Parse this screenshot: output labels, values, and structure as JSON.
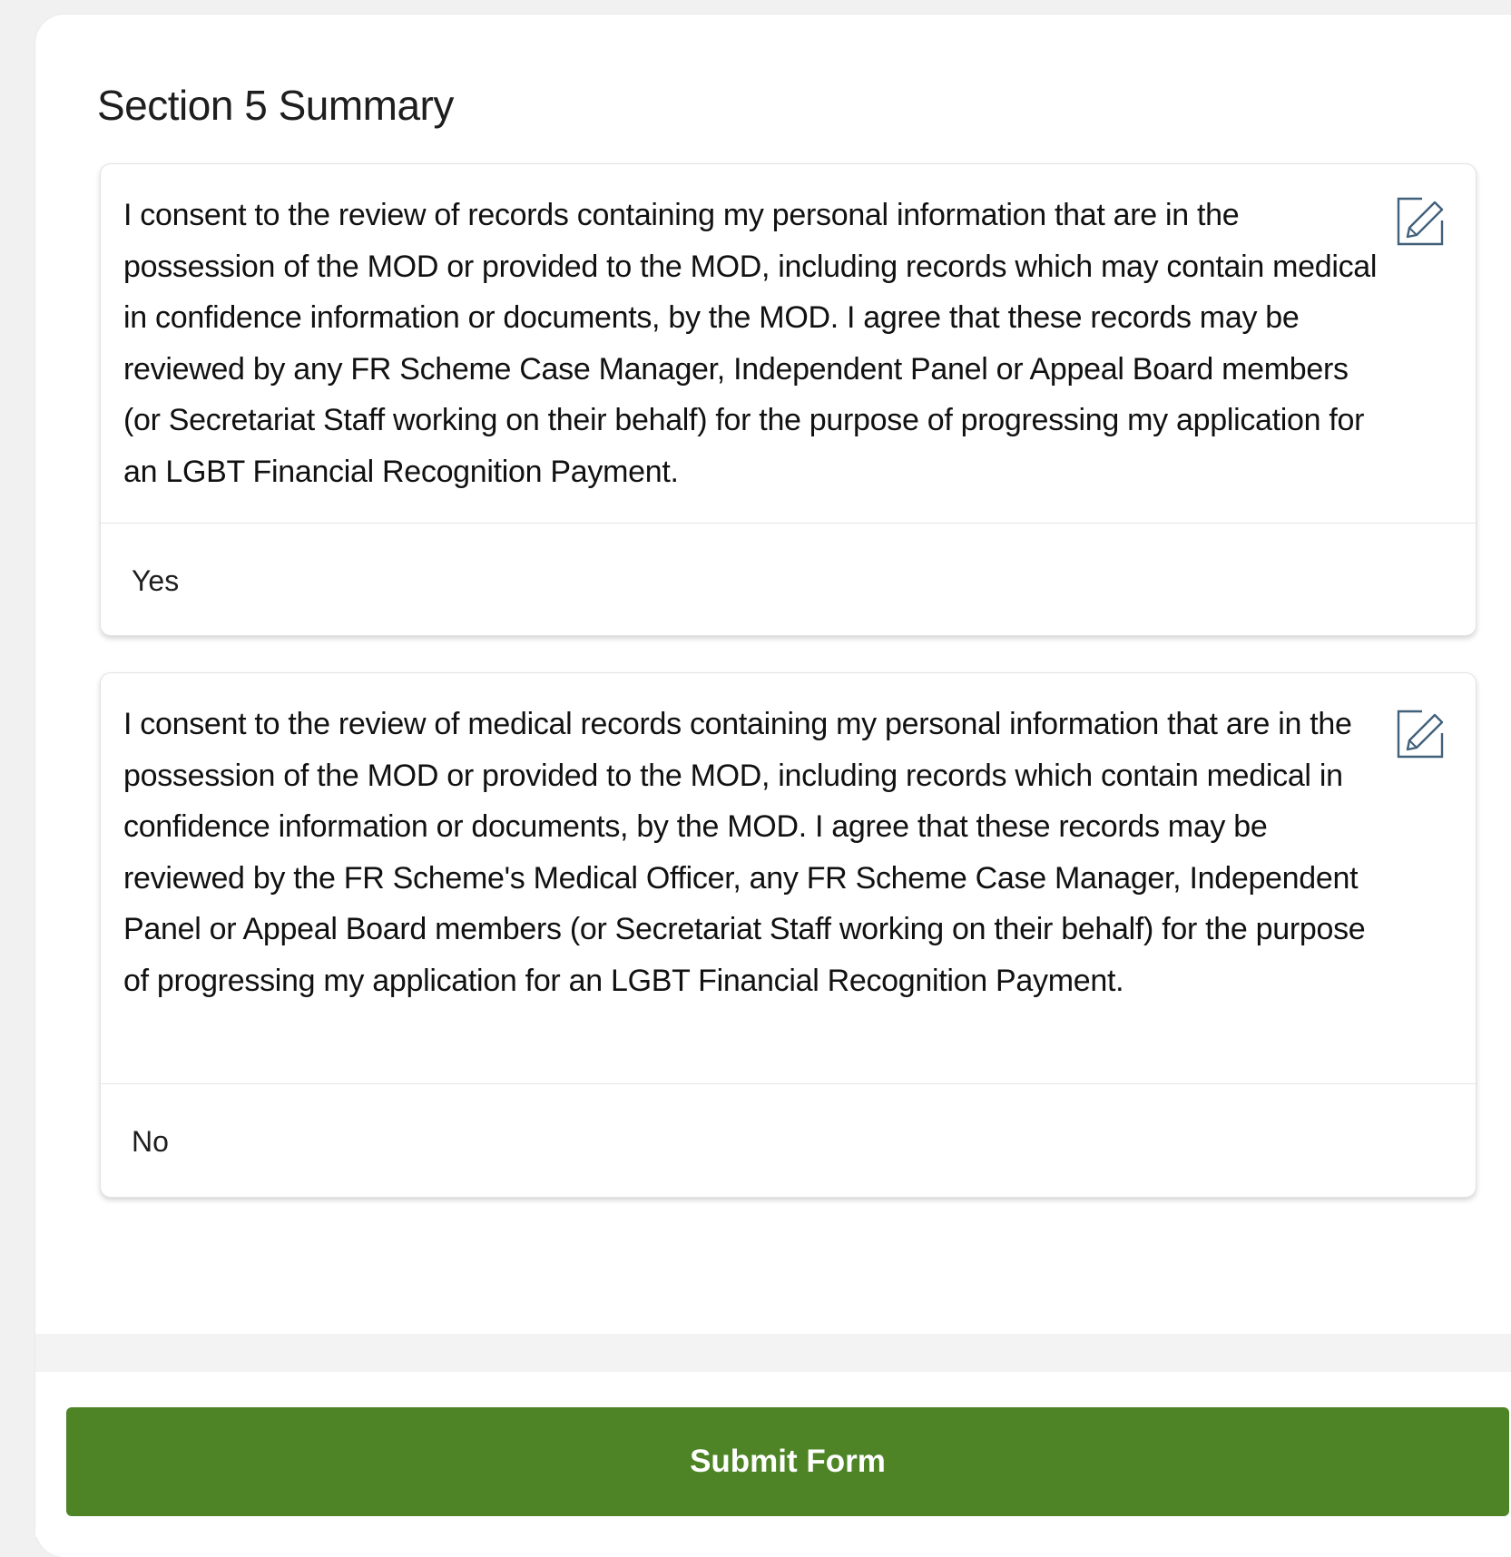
{
  "section": {
    "title": "Section 5 Summary"
  },
  "cards": [
    {
      "question": "I consent to the review of records containing my personal information that are in the possession of the MOD or provided to the MOD, including records which may contain medical in confidence information or documents, by the MOD. I agree that these records may be reviewed by any FR Scheme Case Manager, Independent Panel or Appeal Board members (or Secretariat Staff working on their behalf) for the purpose of progressing my application for an LGBT Financial Recognition Payment.",
      "answer": "Yes",
      "edit_icon": "edit-icon"
    },
    {
      "question": "I consent to the review of medical records containing my personal information that are in the possession of the MOD or provided to the MOD, including records which contain medical in confidence information or documents, by the MOD. I agree that these records may be reviewed by the FR Scheme's Medical Officer, any FR Scheme Case Manager, Independent Panel or Appeal Board members (or Secretariat Staff working on their behalf) for the purpose of progressing my application for an LGBT Financial Recognition Payment.",
      "answer": "No",
      "edit_icon": "edit-icon"
    }
  ],
  "footer": {
    "submit_label": "Submit Form"
  },
  "colors": {
    "submit_background": "#4e8426",
    "edit_icon": "#41607a",
    "page_background": "#f1f1f2"
  }
}
